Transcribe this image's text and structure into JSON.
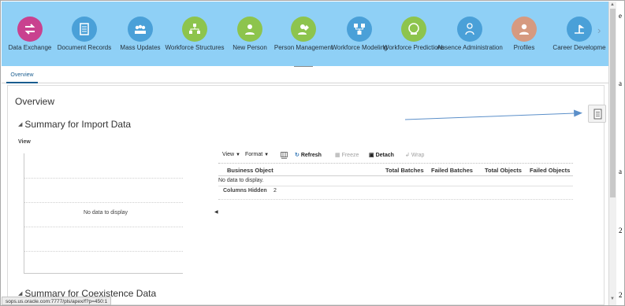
{
  "springboard": {
    "items": [
      {
        "label": "Data Exchange",
        "icon": "data-exchange-icon",
        "color": "#c9418f"
      },
      {
        "label": "Document Records",
        "icon": "document-records-icon",
        "color": "#4aa0d8"
      },
      {
        "label": "Mass Updates",
        "icon": "mass-updates-icon",
        "color": "#4aa0d8"
      },
      {
        "label": "Workforce Structures",
        "icon": "workforce-structures-icon",
        "color": "#8dc44d"
      },
      {
        "label": "New Person",
        "icon": "new-person-icon",
        "color": "#8dc44d"
      },
      {
        "label": "Person Management",
        "icon": "person-management-icon",
        "color": "#8dc44d"
      },
      {
        "label": "Workforce Modeling",
        "icon": "workforce-modeling-icon",
        "color": "#4aa0d8"
      },
      {
        "label": "Workforce Predictions",
        "icon": "workforce-predictions-icon",
        "color": "#8dc44d"
      },
      {
        "label": "Absence Administration",
        "icon": "absence-administration-icon",
        "color": "#4aa0d8"
      },
      {
        "label": "Profiles",
        "icon": "profiles-icon",
        "color": "#d69a80"
      },
      {
        "label": "Career Developme",
        "icon": "career-development-icon",
        "color": "#4aa0d8"
      }
    ],
    "next_arrow": "›"
  },
  "tabs": {
    "overview": "Overview"
  },
  "main": {
    "title": "Overview",
    "section1_title": "Summary for Import Data",
    "view_label": "View",
    "chart_no_data": "No data to display",
    "toolbar": {
      "view": "View",
      "format": "Format",
      "refresh": "Refresh",
      "freeze": "Freeze",
      "detach": "Detach",
      "wrap": "Wrap"
    },
    "table": {
      "columns": [
        "Business Object",
        "Total Batches",
        "Failed Batches",
        "Total Objects",
        "Failed Objects"
      ],
      "no_data": "No data to display.",
      "columns_hidden_label": "Columns Hidden",
      "columns_hidden_value": "2"
    },
    "section2_title": "Summary for Coexistence Data"
  },
  "status_url": "sops.us.oracle.com:7777/pls/apex/f?p=450:1",
  "edge_chars": [
    "e",
    "a",
    "a",
    "2",
    "2"
  ],
  "colors": {
    "springboard_bg": "#8fd0f6",
    "annotation_arrow": "#5b8fc9",
    "link": "#1a5d8f"
  }
}
